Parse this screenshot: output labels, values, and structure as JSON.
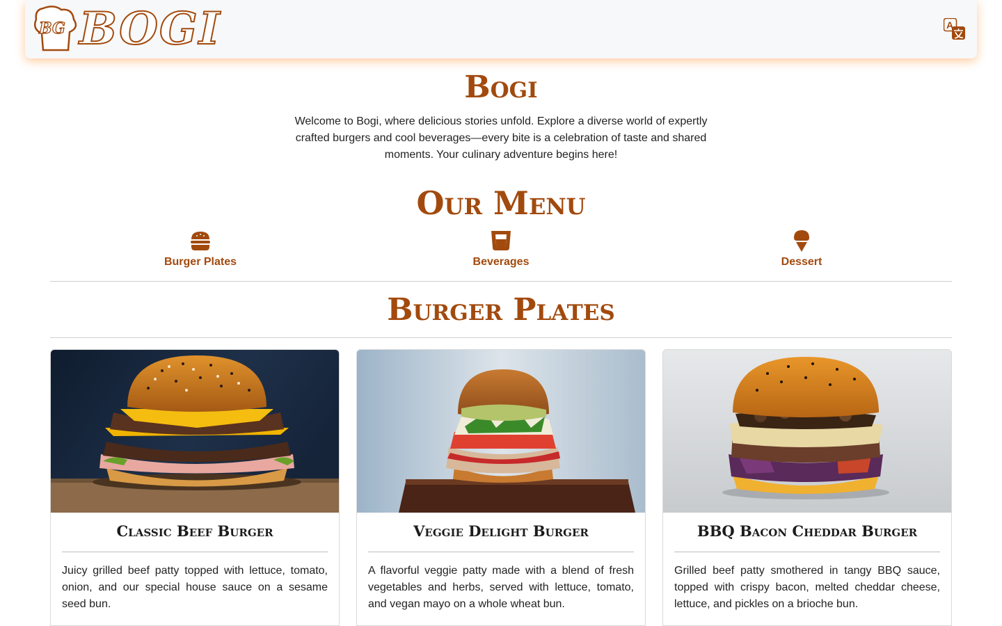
{
  "header": {
    "logo_text": "BOGI",
    "logo_badge": "BG",
    "translate_icon": "translate-icon"
  },
  "hero": {
    "brand_title": "Bogi",
    "intro": "Welcome to Bogi, where delicious stories unfold. Explore a diverse world of expertly crafted burgers and cool beverages—every bite is a celebration of taste and shared moments. Your culinary adventure begins here!"
  },
  "menu": {
    "title": "Our Menu",
    "tabs": [
      {
        "label": "Burger Plates",
        "icon": "burger-icon"
      },
      {
        "label": "Beverages",
        "icon": "glass-icon"
      },
      {
        "label": "Dessert",
        "icon": "ice-cream-icon"
      }
    ]
  },
  "section": {
    "title": "Burger Plates",
    "items": [
      {
        "name": "Classic Beef Burger",
        "description": "Juicy grilled beef patty topped with lettuce, tomato, onion, and our special house sauce on a sesame seed bun."
      },
      {
        "name": "Veggie Delight Burger",
        "description": "A flavorful veggie patty made with a blend of fresh vegetables and herbs, served with lettuce, tomato, and vegan mayo on a whole wheat bun."
      },
      {
        "name": "BBQ Bacon Cheddar Burger",
        "description": "Grilled beef patty smothered in tangy BBQ sauce, topped with crispy bacon, melted cheddar cheese, lettuce, and pickles on a brioche bun."
      }
    ]
  },
  "colors": {
    "accent": "#a24a0e",
    "header_bg": "#f7f8fa",
    "header_glow": "#ff8c28"
  }
}
